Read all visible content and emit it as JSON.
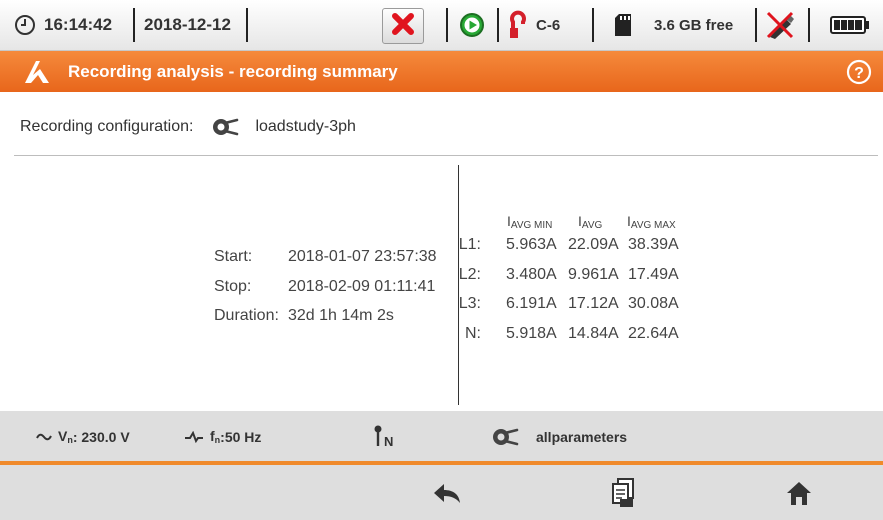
{
  "status": {
    "time": "16:14:42",
    "date": "2018-12-12",
    "clamp": "C-6",
    "storage": "3.6 GB free"
  },
  "titlebar": {
    "title": "Recording analysis - recording summary"
  },
  "config": {
    "label": "Recording configuration:",
    "name": "loadstudy-3ph"
  },
  "times": {
    "start_label": "Start:",
    "start": "2018-01-07 23:57:38",
    "stop_label": "Stop:",
    "stop": "2018-02-09 01:11:41",
    "duration_label": "Duration:",
    "duration": "32d 1h 14m 2s"
  },
  "currents": {
    "rows": [
      {
        "label": "L1:",
        "min": "5.963A",
        "avg": "22.09A",
        "max": "38.39A"
      },
      {
        "label": "L2:",
        "min": "3.480A",
        "avg": "9.961A",
        "max": "17.49A"
      },
      {
        "label": "L3:",
        "min": "6.191A",
        "avg": "17.12A",
        "max": "30.08A"
      },
      {
        "label": "N:",
        "min": "5.918A",
        "avg": "14.84A",
        "max": "22.64A"
      }
    ]
  },
  "info": {
    "voltage": ": 230.0 V",
    "frequency": ":50 Hz",
    "profile": "allparameters"
  },
  "icons": {
    "clock": "clock-icon",
    "stop": "close-icon",
    "play": "play-icon",
    "clamp": "clamp-icon",
    "sd": "sd-card-icon",
    "usb": "usb-disconnected-icon",
    "battery": "battery-icon",
    "logo": "logo-icon",
    "help": "help-icon",
    "config": "config-icon",
    "back": "back-icon",
    "report": "report-icon",
    "home": "home-icon"
  },
  "colors": {
    "accent": "#ee7023",
    "stop": "#e0141e",
    "play": "#27a834",
    "clamp": "#d4202b"
  }
}
